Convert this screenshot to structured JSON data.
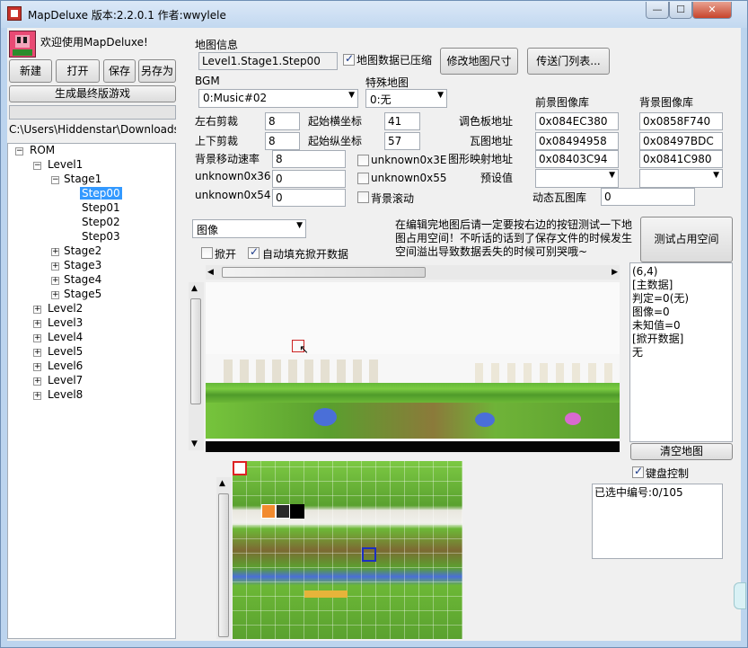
{
  "window": {
    "title": "MapDeluxe 版本:2.2.0.1 作者:wwylele",
    "minimize_glyph": "—",
    "maximize_glyph": "☐",
    "close_glyph": "✕"
  },
  "welcome": {
    "text": "欢迎使用MapDeluxe!",
    "icon": "kirby-app-icon"
  },
  "toolbar": {
    "new_label": "新建",
    "open_label": "打开",
    "save_label": "保存",
    "save_as_label": "另存为",
    "build_label": "生成最终版游戏"
  },
  "path": {
    "text": "C:\\Users\\Hiddenstar\\Downloads\\M"
  },
  "tree": {
    "root": "ROM",
    "level1": "Level1",
    "stage1": "Stage1",
    "steps": [
      "Step00",
      "Step01",
      "Step02",
      "Step03"
    ],
    "stages": [
      "Stage2",
      "Stage3",
      "Stage4",
      "Stage5"
    ],
    "levels": [
      "Level2",
      "Level3",
      "Level4",
      "Level5",
      "Level6",
      "Level7",
      "Level8"
    ]
  },
  "map_info": {
    "group_label": "地图信息",
    "map_name": "Level1.Stage1.Step00",
    "compressed_label": "地图数据已压缩",
    "compressed_checked": true,
    "resize_button": "修改地图尺寸",
    "portal_button": "传送门列表...",
    "bgm_label": "BGM",
    "bgm_value": "0:Music#02",
    "special_map_label": "特殊地图",
    "special_map_value": "0:无",
    "lr_clip_label": "左右剪裁",
    "lr_clip_value": "8",
    "ud_clip_label": "上下剪裁",
    "ud_clip_value": "8",
    "start_x_label": "起始横坐标",
    "start_x_value": "41",
    "start_y_label": "起始纵坐标",
    "start_y_value": "57",
    "bg_speed_label": "背景移动速率",
    "bg_speed_value": "8",
    "unk36_label": "unknown0x36",
    "unk36_value": "0",
    "unk54_label": "unknown0x54",
    "unk54_value": "0",
    "unk3e_label": "unknown0x3E",
    "unk55_label": "unknown0x55",
    "bg_scroll_label": "背景滚动",
    "fg_lib_label": "前景图像库",
    "bg_lib_label": "背景图像库",
    "palette_label": "调色板地址",
    "palette_fg": "0x084EC380",
    "palette_bg": "0x0858F740",
    "tile_label": "瓦图地址",
    "tile_fg": "0x08494958",
    "tile_bg": "0x08497BDC",
    "tilemap_label": "图形映射地址",
    "tilemap_fg": "0x08403C94",
    "tilemap_bg": "0x0841C980",
    "preset_label": "预设值",
    "dynamic_label": "动态瓦图库",
    "dynamic_value": "0"
  },
  "view": {
    "mode_value": "图像",
    "pickup_label": "掀开",
    "auto_fill_label": "自动填充掀开数据",
    "auto_fill_checked": true,
    "notice": "在编辑完地图后请一定要按右边的按钮测试一下地图占用空间！不听话的话到了保存文件的时候发生空间溢出导致数据丢失的时候可别哭哦~",
    "test_space_button": "测试占用空间"
  },
  "info_panel": {
    "lines": [
      "(6,4)",
      "[主数据]",
      "判定=0(无)",
      "图像=0",
      "未知值=0",
      "[掀开数据]",
      "无"
    ]
  },
  "clear_map_button": "清空地图",
  "keyboard": {
    "label": "键盘控制",
    "checked": true
  },
  "selected": {
    "text": "已选中编号:0/105"
  },
  "colors": {
    "selection": "#3399ff",
    "title_bar": "#c2d8f0",
    "client_bg": "#f0f0f0",
    "grass": "#6cb836"
  }
}
